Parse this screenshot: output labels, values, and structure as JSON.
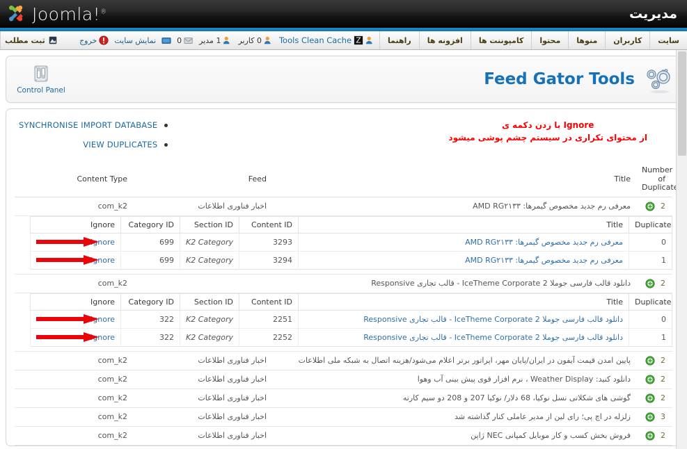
{
  "topbar": {
    "brand": "Joomla!",
    "brand_mark": "®",
    "admin_title": "مدیریت"
  },
  "menu": {
    "items": [
      {
        "label": "سایت",
        "name": "site"
      },
      {
        "label": "کاربران",
        "name": "users"
      },
      {
        "label": "منوها",
        "name": "menus"
      },
      {
        "label": "محتوا",
        "name": "content"
      },
      {
        "label": "کامپوننت ها",
        "name": "components"
      },
      {
        "label": "افزونه ها",
        "name": "extensions"
      },
      {
        "label": "راهنما",
        "name": "help"
      }
    ],
    "tools_link": "Tools Clean Cache",
    "status": {
      "users_count": "0 کاربر",
      "admins_count": "1 مدیر",
      "messages_count": "0",
      "preview_label": "نمایش سایت",
      "logout_label": "خروج"
    },
    "post_article": "ثبت مطلب"
  },
  "header": {
    "control_panel_label": "Control Panel",
    "page_title": "Feed Gator Tools",
    "gears_icon": "gears-icon",
    "control_panel_icon": "control-panel-icon"
  },
  "notice": {
    "line1_fa": "با زدن دکمه ی",
    "line1_en": "Ignore",
    "line2_fa": "از محتوای تکراری در سیستم چشم پوشی میشود",
    "color": "#ff0000"
  },
  "actions": [
    {
      "label": "SYNCHRONISE IMPORT DATABASE",
      "name": "synchronise-import-database"
    },
    {
      "label": "VIEW DUPLICATES",
      "name": "view-duplicates"
    }
  ],
  "table": {
    "headers": {
      "content_type": "Content Type",
      "feed": "Feed",
      "title": "Title",
      "number_of_duplicates_l1": "Number of",
      "number_of_duplicates_l2": "Duplicates"
    },
    "detail_headers": {
      "ignore": "Ignore",
      "category_id": "Category ID",
      "section_id": "Section ID",
      "content_id": "Content ID",
      "title": "Title",
      "duplicate": "Duplicate"
    },
    "ignore_label": "Ignore",
    "rows": [
      {
        "content_type": "com_k2",
        "feed": "اخبار فناوری اطلاعات",
        "title": "معرفی رم جدید مخصوص گیمرها: AMD RG۲۱۳۳",
        "count": "2",
        "expanded": true,
        "details": [
          {
            "ignore": "Ignore",
            "category_id": "699",
            "section_id": "K2 Category",
            "content_id": "3293",
            "title": "معرفی رم جدید مخصوص گیمرها: AMD RG۲۱۳۳",
            "duplicate": "0",
            "arrow": true
          },
          {
            "ignore": "Ignore",
            "category_id": "699",
            "section_id": "K2 Category",
            "content_id": "3294",
            "title": "معرفی رم جدید مخصوص گیمرها: AMD RG۲۱۳۳",
            "duplicate": "1",
            "arrow": true
          }
        ]
      },
      {
        "content_type": "com_k2",
        "feed": "",
        "title": "دانلود قالب فارسی جوملا IceTheme Corporate 2 - قالب تجاری Responsive",
        "count": "2",
        "expanded": true,
        "details": [
          {
            "ignore": "Ignore",
            "category_id": "322",
            "section_id": "K2 Category",
            "content_id": "2251",
            "title": "دانلود قالب فارسی جوملا IceTheme Corporate 2 - قالب تجاری Responsive",
            "duplicate": "0",
            "arrow": true
          },
          {
            "ignore": "Ignore",
            "category_id": "322",
            "section_id": "K2 Category",
            "content_id": "2252",
            "title": "دانلود قالب فارسی جوملا IceTheme Corporate 2 - قالب تجاری Responsive",
            "duplicate": "1",
            "arrow": true
          }
        ]
      },
      {
        "content_type": "com_k2",
        "feed": "اخبار فناوری اطلاعات",
        "title": "پایین امدن قیمت آیفون در ایران/پایان مهر، اپراتور برتر اعلام می‌شود/هزینه اتصال به شبکه ملی اطلاعات",
        "count": "2",
        "expanded": false,
        "details": []
      },
      {
        "content_type": "com_k2",
        "feed": "اخبار فناوری اطلاعات",
        "title": "دانلود کنید: Weather Display ، نرم افزار قوی پیش بینی آب وهوا",
        "count": "2",
        "expanded": false,
        "details": []
      },
      {
        "content_type": "com_k2",
        "feed": "اخبار فناوری اطلاعات",
        "title": "گوشی های شکلاتی نسل نوکیا، 68 دلار/ نوکیا 207 و 208 دو سیم کارته",
        "count": "2",
        "expanded": false,
        "details": []
      },
      {
        "content_type": "com_k2",
        "feed": "اخبار فناوری اطلاعات",
        "title": "زلزله در اچ پی؛ رای لین از مدیر عاملی کنار گذاشته شد",
        "count": "3",
        "expanded": false,
        "details": []
      },
      {
        "content_type": "com_k2",
        "feed": "اخبار فناوری اطلاعات",
        "title": "فروش بخش کسب و کار موبایل کمپانی NEC ژاپن",
        "count": "2",
        "expanded": false,
        "details": []
      }
    ]
  },
  "colors": {
    "accent_blue": "#1672b8",
    "link_blue": "#2f6fa8",
    "notice_red": "#ff0000",
    "green": "#3d9b35",
    "stripe": "#1d8cc4"
  }
}
